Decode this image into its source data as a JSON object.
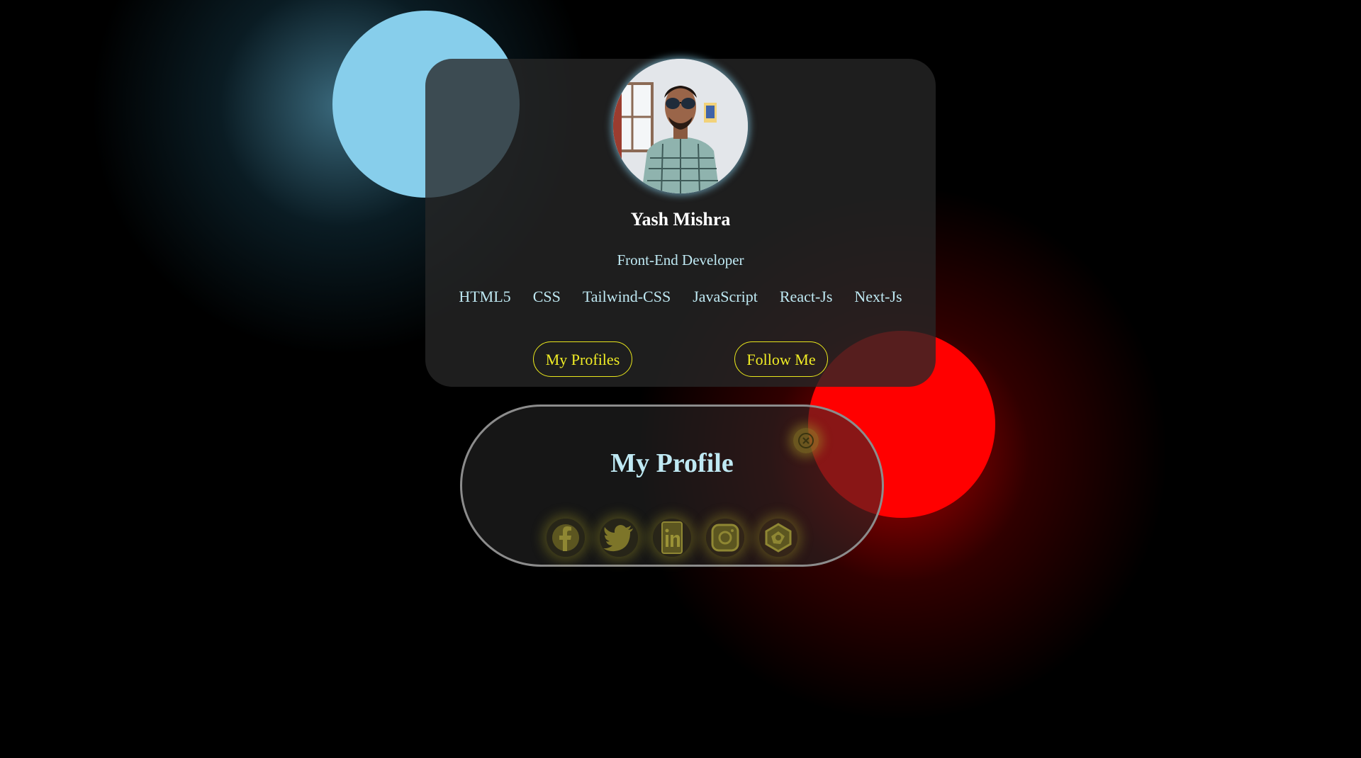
{
  "colors": {
    "background": "#000000",
    "blue_blob": "#87ceeb",
    "red_blob": "#ff0000",
    "accent_yellow": "#f0ec25",
    "text_light_blue": "#bfe9f3"
  },
  "profile_card": {
    "avatar_alt": "profile photo",
    "name": "Yash Mishra",
    "role": "Front-End Developer",
    "skills": [
      "HTML5",
      "CSS",
      "Tailwind-CSS",
      "JavaScript",
      "React-Js",
      "Next-Js"
    ],
    "buttons": {
      "profiles": "My Profiles",
      "follow": "Follow Me"
    }
  },
  "profile_panel": {
    "title": "My Profile",
    "close_icon": "close-icon",
    "social_icons": [
      "facebook-icon",
      "twitter-icon",
      "linkedin-icon",
      "instagram-icon",
      "codepen-icon"
    ]
  }
}
